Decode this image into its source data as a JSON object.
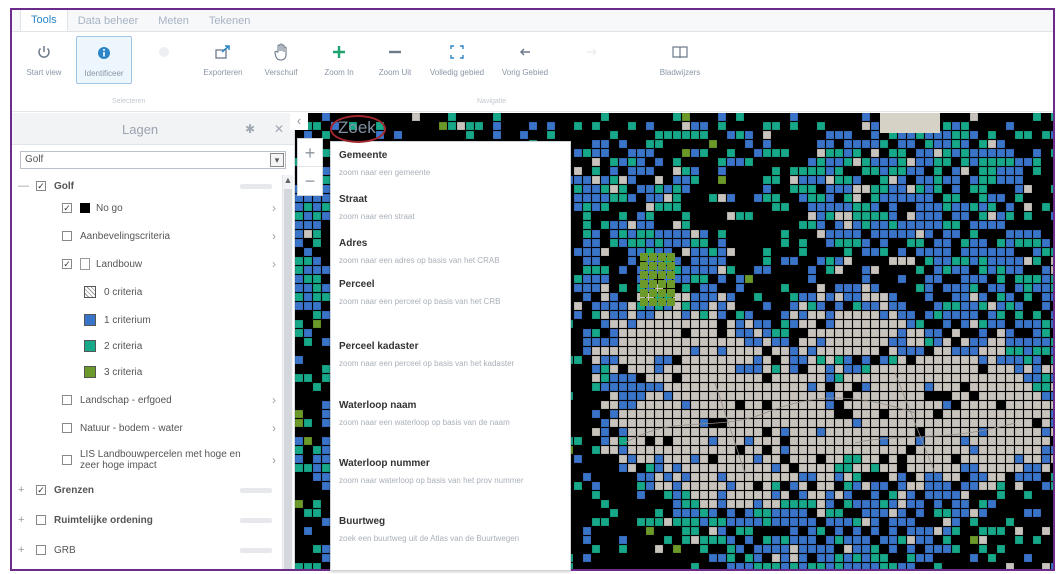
{
  "tabs": [
    {
      "label": "Tools",
      "active": true
    },
    {
      "label": "Data beheer",
      "active": false
    },
    {
      "label": "Meten",
      "active": false
    },
    {
      "label": "Tekenen",
      "active": false
    }
  ],
  "toolbar": {
    "tools": [
      {
        "label": "Start view",
        "icon": "power-icon",
        "selected": false,
        "faded": false
      },
      {
        "label": "Identificeer",
        "icon": "info-icon",
        "selected": true,
        "faded": false
      },
      {
        "label": "",
        "icon": "blank-icon",
        "selected": false,
        "faded": true
      },
      {
        "label": "Exporteren",
        "icon": "export-icon",
        "selected": false,
        "faded": false
      },
      {
        "label": "Verschuif",
        "icon": "pan-hand-icon",
        "selected": false,
        "faded": false
      },
      {
        "label": "Zoom In",
        "icon": "zoom-in-icon",
        "selected": false,
        "faded": false
      },
      {
        "label": "Zoom Uit",
        "icon": "zoom-out-icon",
        "selected": false,
        "faded": false
      },
      {
        "label": "Volledig gebied",
        "icon": "full-extent-icon",
        "selected": false,
        "faded": false
      },
      {
        "label": "Vorig Gebied",
        "icon": "previous-extent-icon",
        "selected": false,
        "faded": false
      },
      {
        "label": "",
        "icon": "next-extent-icon",
        "selected": false,
        "faded": true
      },
      {
        "label": "Bladwijzers",
        "icon": "bookmarks-icon",
        "selected": false,
        "faded": false
      }
    ],
    "group_labels": [
      "Selecteren",
      "Navigatie"
    ]
  },
  "layers_panel": {
    "title": "Lagen",
    "dropdown_value": "Golf",
    "items": [
      {
        "label": "Golf",
        "checked": true,
        "level": 0,
        "kind": "group",
        "bold": true
      },
      {
        "label": "No go",
        "checked": true,
        "level": 1,
        "kind": "layer-black"
      },
      {
        "label": "Aanbevelingscriteria",
        "checked": false,
        "level": 1,
        "kind": "layer"
      },
      {
        "label": "Landbouw",
        "checked": true,
        "level": 1,
        "kind": "layer-icon"
      },
      {
        "label": "0 criteria",
        "level": 2,
        "kind": "legend",
        "swatch": "hatch"
      },
      {
        "label": "1 criterium",
        "level": 2,
        "kind": "legend",
        "swatch": "#3a74c9"
      },
      {
        "label": "2 criteria",
        "level": 2,
        "kind": "legend",
        "swatch": "#17a889"
      },
      {
        "label": "3 criteria",
        "level": 2,
        "kind": "legend",
        "swatch": "#6c9a2a"
      },
      {
        "label": "Landschap - erfgoed",
        "checked": false,
        "level": 1,
        "kind": "layer"
      },
      {
        "label": "Natuur - bodem - water",
        "checked": false,
        "level": 1,
        "kind": "layer"
      },
      {
        "label": "LIS Landbouwpercelen met hoge en zeer hoge impact",
        "checked": false,
        "level": 1,
        "kind": "layer-2line"
      },
      {
        "label": "Grenzen",
        "checked": true,
        "level": 0,
        "kind": "group",
        "bold": true
      },
      {
        "label": "Ruimtelijke ordening",
        "checked": false,
        "level": 0,
        "kind": "group",
        "bold": true
      },
      {
        "label": "GRB",
        "checked": false,
        "level": 0,
        "kind": "group",
        "bold": false
      }
    ]
  },
  "map": {
    "search_label": "Zoek",
    "search_options": [
      {
        "title": "Gemeente",
        "desc": "zoom naar een gemeente"
      },
      {
        "title": "Straat",
        "desc": "zoom naar een straat"
      },
      {
        "title": "Adres",
        "desc": "zoom naar een adres op basis van het CRAB"
      },
      {
        "title": "Perceel",
        "desc": "zoom naar een perceel op basis van het CRB"
      },
      {
        "title": "Perceel kadaster",
        "desc": "zoom naar een perceel op basis van het kadaster"
      },
      {
        "title": "Waterloop naam",
        "desc": "zoom naar een waterloop op basis van de naam"
      },
      {
        "title": "Waterloop nummer",
        "desc": "zoom naar waterloop op basis van het prov nummer"
      },
      {
        "title": "Buurtweg",
        "desc": "zoek een buurtweg uit de Atlas van de Buurtwegen"
      }
    ],
    "colors": {
      "background": "#000000",
      "one_criterion": "#3a74c9",
      "two_criteria": "#17a889",
      "three_criteria": "#6c9a2a",
      "zero_criteria": "#c8c3bd",
      "town": "#d9d4cc"
    }
  }
}
